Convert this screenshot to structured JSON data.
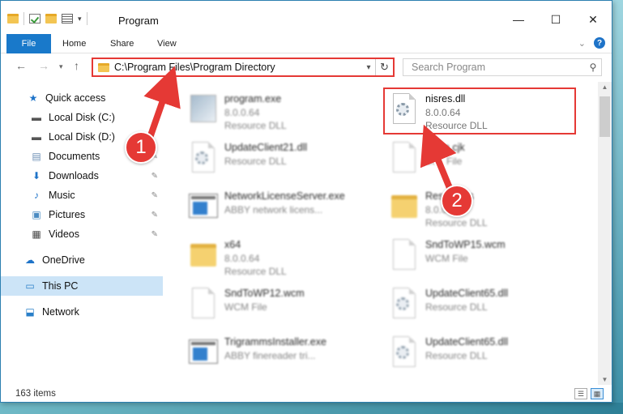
{
  "window": {
    "title": "Program",
    "controls": {
      "minimize": "—",
      "maximize": "☐",
      "close": "✕"
    }
  },
  "ribbon": {
    "tabs": [
      {
        "label": "File"
      },
      {
        "label": "Home"
      },
      {
        "label": "Share"
      },
      {
        "label": "View"
      }
    ],
    "help": "?"
  },
  "address": {
    "path": "C:\\Program Files\\Program Directory",
    "search_placeholder": "Search Program"
  },
  "sidebar": {
    "items": [
      {
        "label": "Quick access",
        "icon": "star-icon",
        "pinned": false
      },
      {
        "label": "Local Disk (C:)",
        "icon": "drive-icon",
        "pinned": false
      },
      {
        "label": "Local Disk (D:)",
        "icon": "drive-icon",
        "pinned": false
      },
      {
        "label": "Documents",
        "icon": "documents-icon",
        "pinned": true
      },
      {
        "label": "Downloads",
        "icon": "download-icon",
        "pinned": true
      },
      {
        "label": "Music",
        "icon": "music-icon",
        "pinned": true
      },
      {
        "label": "Pictures",
        "icon": "pictures-icon",
        "pinned": true
      },
      {
        "label": "Videos",
        "icon": "videos-icon",
        "pinned": true
      },
      {
        "label": "OneDrive",
        "icon": "cloud-icon",
        "pinned": false
      },
      {
        "label": "This PC",
        "icon": "computer-icon",
        "pinned": false,
        "selected": true
      },
      {
        "label": "Network",
        "icon": "network-icon",
        "pinned": false
      }
    ]
  },
  "files": [
    {
      "name": "program.exe",
      "line2": "8.0.0.64",
      "line3": "Resource DLL",
      "icon": "program-icon",
      "blurred": true
    },
    {
      "name": "nisres.dll",
      "line2": "8.0.0.64",
      "line3": "Resource DLL",
      "icon": "dll-gear-icon",
      "blurred": false,
      "highlighted": true
    },
    {
      "name": "UpdateClient21.dll",
      "line2": "Resource DLL",
      "line3": "",
      "icon": "dll-gear-icon",
      "blurred": true
    },
    {
      "name": "clean.cjk",
      "line2": "CJK File",
      "line3": "",
      "icon": "blank-file-icon",
      "blurred": true
    },
    {
      "name": "NetworkLicenseServer.exe",
      "line2": "ABBY network licens...",
      "line3": "",
      "icon": "exe-icon",
      "blurred": true
    },
    {
      "name": "Resources",
      "line2": "8.0.0.64",
      "line3": "Resource DLL",
      "icon": "folder-icon",
      "blurred": true
    },
    {
      "name": "x64",
      "line2": "8.0.0.64",
      "line3": "Resource DLL",
      "icon": "folder-icon",
      "blurred": true
    },
    {
      "name": "SndToWP15.wcm",
      "line2": "WCM File",
      "line3": "",
      "icon": "blank-file-icon",
      "blurred": true
    },
    {
      "name": "SndToWP12.wcm",
      "line2": "WCM File",
      "line3": "",
      "icon": "blank-file-icon",
      "blurred": true
    },
    {
      "name": "UpdateClient65.dll",
      "line2": "Resource DLL",
      "line3": "",
      "icon": "dll-gear-icon",
      "blurred": true
    },
    {
      "name": "TrigrammsInstaller.exe",
      "line2": "ABBY finereader tri...",
      "line3": "",
      "icon": "exe-icon",
      "blurred": true
    },
    {
      "name": "UpdateClient65.dll",
      "line2": "Resource DLL",
      "line3": "",
      "icon": "dll-gear-icon",
      "blurred": true
    }
  ],
  "status": {
    "item_count": "163 items"
  },
  "callouts": [
    {
      "label": "1"
    },
    {
      "label": "2"
    }
  ],
  "colors": {
    "accent": "#1979ca",
    "annotation_red": "#e53935",
    "selection": "#cce4f7"
  }
}
